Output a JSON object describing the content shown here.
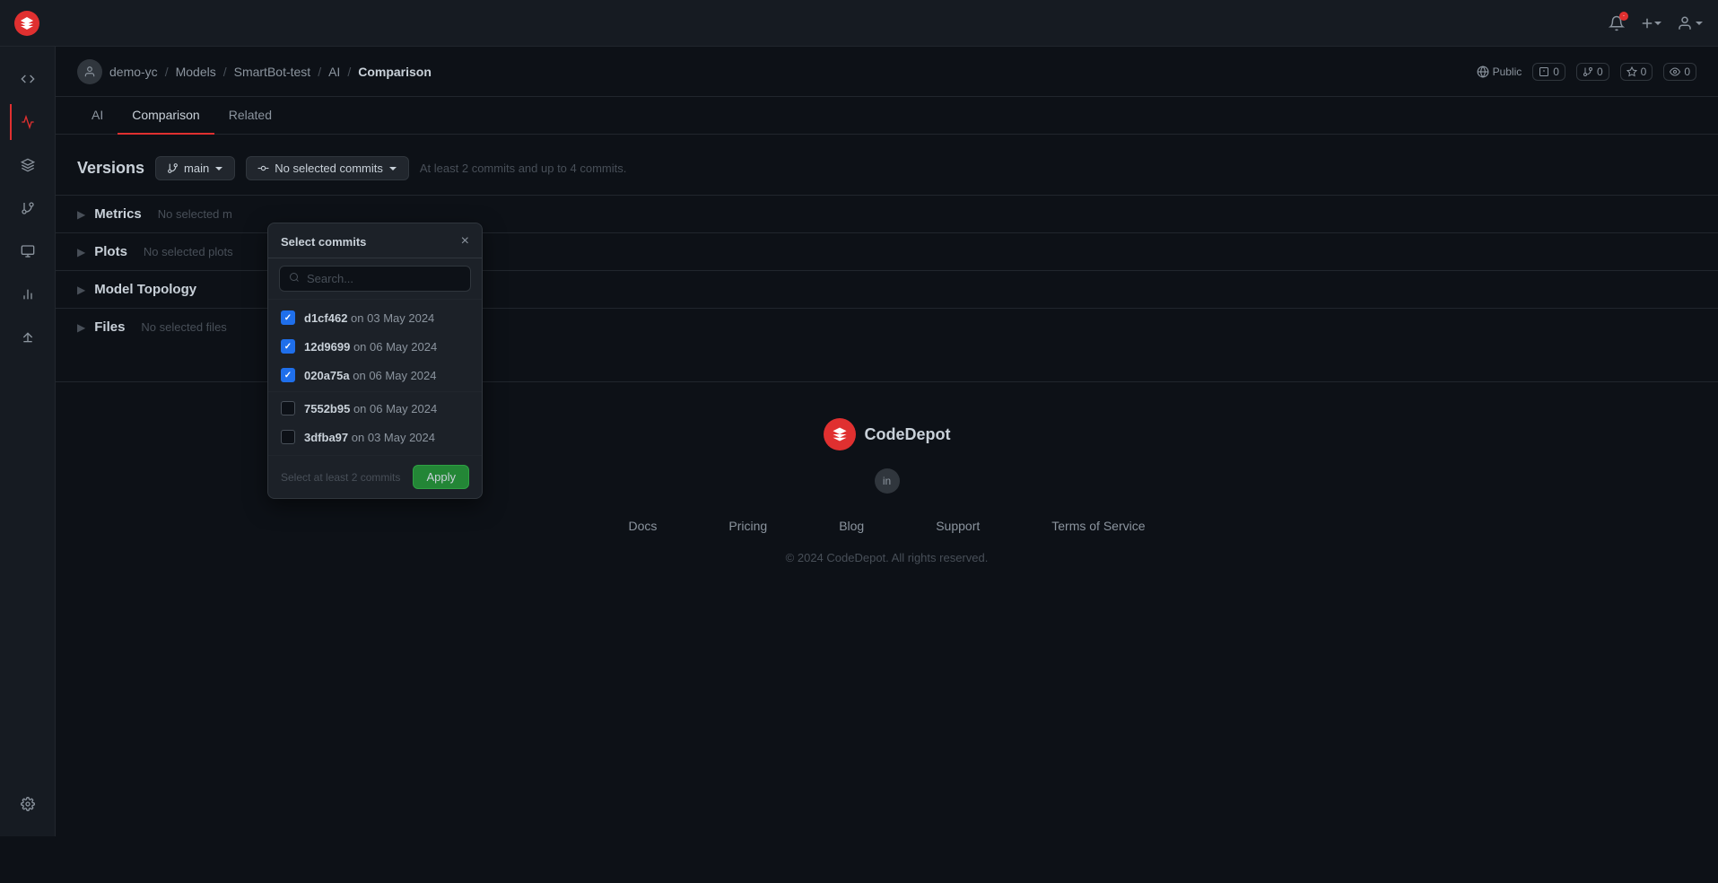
{
  "app": {
    "logo_text": "~",
    "title": "CodeDepot"
  },
  "topnav": {
    "notification_icon": "🔔",
    "plus_icon": "+",
    "user_icon": "👤"
  },
  "breadcrumb": {
    "org": "demo-yc",
    "sep1": "/",
    "repo": "Models",
    "sep2": "/",
    "subrepo": "SmartBot-test",
    "sep3": "/",
    "section": "AI",
    "sep4": "/",
    "current": "Comparison",
    "visibility": "Public",
    "stats": [
      {
        "icon": "☐",
        "value": "0"
      },
      {
        "icon": "⑂",
        "value": "0"
      },
      {
        "icon": "☆",
        "value": "0"
      },
      {
        "icon": "👁",
        "value": "0"
      }
    ]
  },
  "tabs": [
    {
      "label": "AI",
      "active": false
    },
    {
      "label": "Comparison",
      "active": true
    },
    {
      "label": "Related",
      "active": false
    }
  ],
  "sidebar": {
    "items": [
      {
        "icon": "<>",
        "name": "code"
      },
      {
        "icon": "⚡",
        "name": "activity",
        "active": true
      },
      {
        "icon": "✦",
        "name": "models"
      },
      {
        "icon": "⑂",
        "name": "branches"
      },
      {
        "icon": "▦",
        "name": "registry"
      },
      {
        "icon": "∥",
        "name": "analytics"
      },
      {
        "icon": "🚀",
        "name": "deploy"
      }
    ],
    "bottom": [
      {
        "icon": "⚙",
        "name": "settings"
      }
    ]
  },
  "versions": {
    "title": "Versions",
    "branch_label": "main",
    "commits_label": "No selected commits",
    "hint": "At least 2 commits and up to 4 commits."
  },
  "select_commits_dialog": {
    "title": "Select commits",
    "close_label": "×",
    "search_placeholder": "Search...",
    "commits": [
      {
        "hash": "d1cf462",
        "date": "on 03 May 2024",
        "checked": true
      },
      {
        "hash": "12d9699",
        "date": "on 06 May 2024",
        "checked": true
      },
      {
        "hash": "020a75a",
        "date": "on 06 May 2024",
        "checked": true
      },
      {
        "hash": "7552b95",
        "date": "on 06 May 2024",
        "checked": false
      },
      {
        "hash": "3dfba97",
        "date": "on 03 May 2024",
        "checked": false
      }
    ],
    "footer_hint": "Select at least 2 commits",
    "apply_label": "Apply"
  },
  "sections": [
    {
      "title": "Metrics",
      "hint": "No selected m"
    },
    {
      "title": "Plots",
      "hint": "No selected plots"
    },
    {
      "title": "Model Topology",
      "hint": ""
    },
    {
      "title": "Files",
      "hint": "No selected files"
    }
  ],
  "footer": {
    "brand": "CodeDepot",
    "links": [
      "Docs",
      "Pricing",
      "Blog",
      "Support",
      "Terms of Service"
    ],
    "copyright": "© 2024 CodeDepot. All rights reserved."
  }
}
